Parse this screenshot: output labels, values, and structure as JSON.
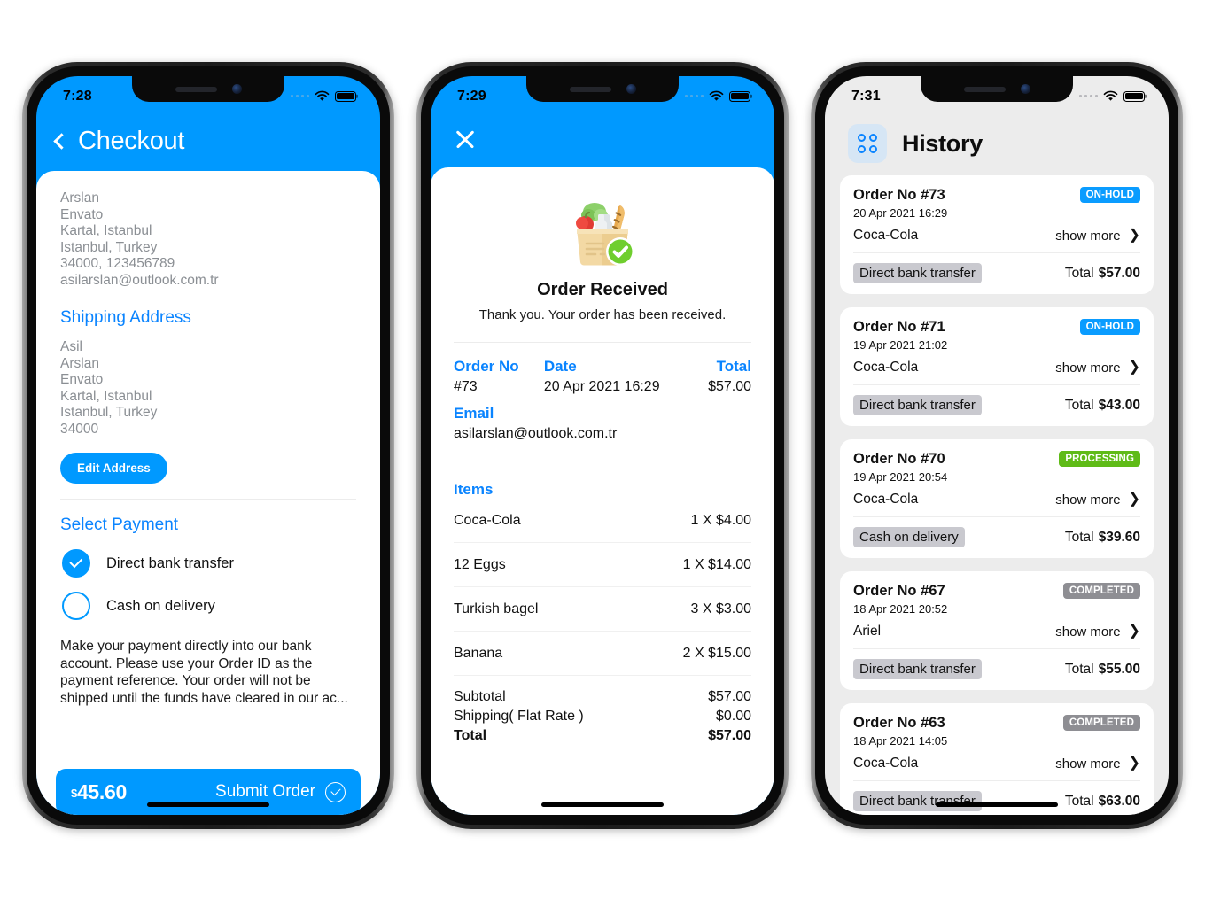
{
  "colors": {
    "accent": "#0099ff",
    "link": "#0a84ff",
    "onhold": "#0a9cff",
    "processing": "#5fbb17",
    "completed": "#8e8e93",
    "bg_gray": "#ececec"
  },
  "phone1": {
    "status": {
      "time": "7:28"
    },
    "nav": {
      "back_icon": "chevron-left-icon",
      "title": "Checkout"
    },
    "billing_address": [
      "Arslan",
      "Envato",
      "Kartal, Istanbul",
      "Istanbul, Turkey",
      "34000, 123456789",
      "asilarslan@outlook.com.tr"
    ],
    "shipping": {
      "title": "Shipping Address",
      "lines": [
        "Asil",
        "Arslan",
        "Envato",
        "Kartal, Istanbul",
        "Istanbul, Turkey",
        "34000"
      ],
      "edit_label": "Edit Address"
    },
    "payment": {
      "title": "Select Payment",
      "options": [
        {
          "label": "Direct bank transfer",
          "selected": true
        },
        {
          "label": "Cash on delivery",
          "selected": false
        }
      ],
      "description": "Make your payment directly into our bank account. Please use your Order ID as the payment reference. Your order will not be shipped until the funds have cleared in our ac..."
    },
    "submit": {
      "currency": "$",
      "amount": "45.60",
      "label": "Submit Order",
      "icon": "check-circle-icon"
    }
  },
  "phone2": {
    "status": {
      "time": "7:29"
    },
    "close_icon": "close-icon",
    "illustration": "grocery-bag-check-icon",
    "title": "Order Received",
    "subtitle": "Thank you. Your order has been received.",
    "summary": {
      "order_no_label": "Order No",
      "order_no_value": "#73",
      "date_label": "Date",
      "date_value": "20 Apr 2021 16:29",
      "total_label": "Total",
      "total_value": "$57.00",
      "email_label": "Email",
      "email_value": "asilarslan@outlook.com.tr"
    },
    "items_label": "Items",
    "items": [
      {
        "name": "Coca-Cola",
        "qty": "1 X $4.00"
      },
      {
        "name": "12 Eggs",
        "qty": "1 X $14.00"
      },
      {
        "name": "Turkish bagel",
        "qty": "3 X $3.00"
      },
      {
        "name": "Banana",
        "qty": "2 X $15.00"
      }
    ],
    "totals": [
      {
        "label": "Subtotal",
        "value": "$57.00",
        "bold": false
      },
      {
        "label": "Shipping( Flat Rate )",
        "value": "$0.00",
        "bold": false
      },
      {
        "label": "Total",
        "value": "$57.00",
        "bold": true
      }
    ]
  },
  "phone3": {
    "status": {
      "time": "7:31"
    },
    "header": {
      "icon": "grid-apps-icon",
      "title": "History"
    },
    "show_more_label": "show more",
    "total_label": "Total",
    "orders": [
      {
        "order_no": "Order No #73",
        "date": "20 Apr 2021 16:29",
        "product": "Coca-Cola",
        "status": "ON-HOLD",
        "status_color": "#0a9cff",
        "payment": "Direct bank transfer",
        "total": "$57.00"
      },
      {
        "order_no": "Order No #71",
        "date": "19 Apr 2021 21:02",
        "product": "Coca-Cola",
        "status": "ON-HOLD",
        "status_color": "#0a9cff",
        "payment": "Direct bank transfer",
        "total": "$43.00"
      },
      {
        "order_no": "Order No #70",
        "date": "19 Apr 2021 20:54",
        "product": "Coca-Cola",
        "status": "PROCESSING",
        "status_color": "#5fbb17",
        "payment": "Cash on delivery",
        "total": "$39.60"
      },
      {
        "order_no": "Order No #67",
        "date": "18 Apr 2021 20:52",
        "product": "Ariel",
        "status": "COMPLETED",
        "status_color": "#8e8e93",
        "payment": "Direct bank transfer",
        "total": "$55.00"
      },
      {
        "order_no": "Order No #63",
        "date": "18 Apr 2021 14:05",
        "product": "Coca-Cola",
        "status": "COMPLETED",
        "status_color": "#8e8e93",
        "payment": "Direct bank transfer",
        "total": "$63.00"
      }
    ]
  }
}
